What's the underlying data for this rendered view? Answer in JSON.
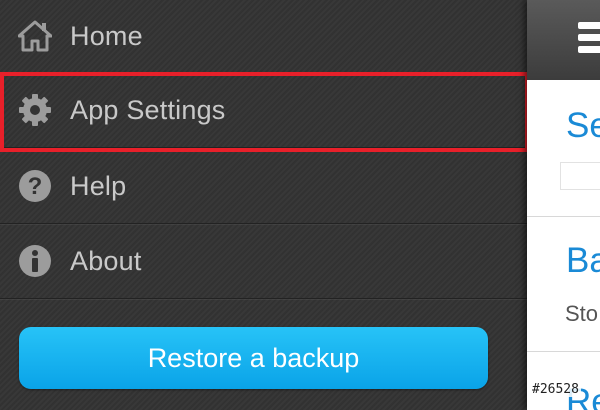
{
  "menu": {
    "items": [
      {
        "label": "Home",
        "icon": "home-icon"
      },
      {
        "label": "App Settings",
        "icon": "gear-icon"
      },
      {
        "label": "Help",
        "icon": "question-icon"
      },
      {
        "label": "About",
        "icon": "info-icon"
      }
    ],
    "restore_label": "Restore a backup"
  },
  "panel": {
    "sections": [
      {
        "title": "Se",
        "subtitle": ""
      },
      {
        "title": "Ba",
        "subtitle": "Sto"
      },
      {
        "title": "Re",
        "subtitle": ""
      }
    ]
  },
  "watermark": "#26528",
  "colors": {
    "drawer_bg": "#333333",
    "menu_text": "#c9c9c9",
    "highlight": "#e8202a",
    "button": "#0aa3e8",
    "link_blue": "#1a8ad6"
  }
}
